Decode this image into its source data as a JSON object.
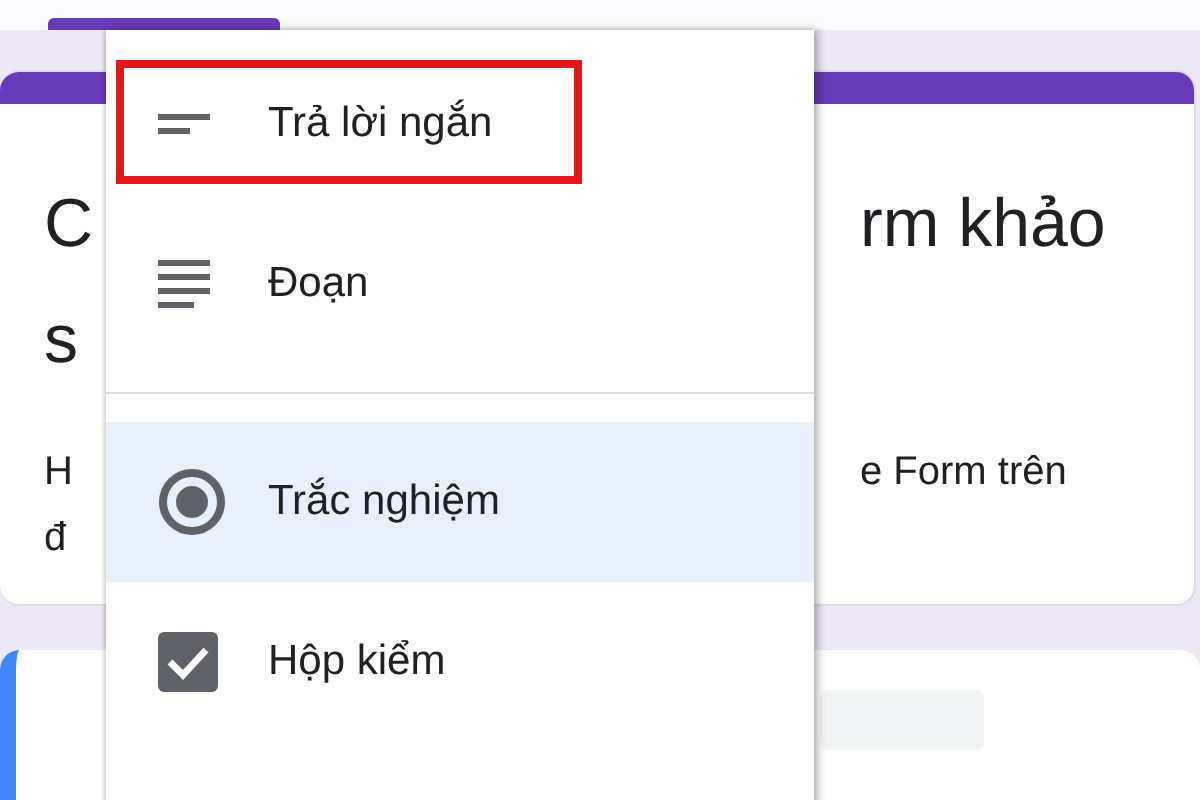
{
  "form_card": {
    "title_left": "C",
    "title_right": "rm khảo",
    "title_line2": "s",
    "description_left": "H",
    "description_right": "e Form trên",
    "description_line2": "đ"
  },
  "question_type_menu": {
    "items": [
      {
        "kind": "short_answer",
        "label": "Trả lời ngắn",
        "selected": false,
        "highlighted": true
      },
      {
        "kind": "paragraph",
        "label": "Đoạn",
        "selected": false,
        "highlighted": false
      },
      {
        "kind": "multiple_choice",
        "label": "Trắc nghiệm",
        "selected": true,
        "highlighted": false
      },
      {
        "kind": "checkboxes",
        "label": "Hộp kiểm",
        "selected": false,
        "highlighted": false
      }
    ]
  }
}
